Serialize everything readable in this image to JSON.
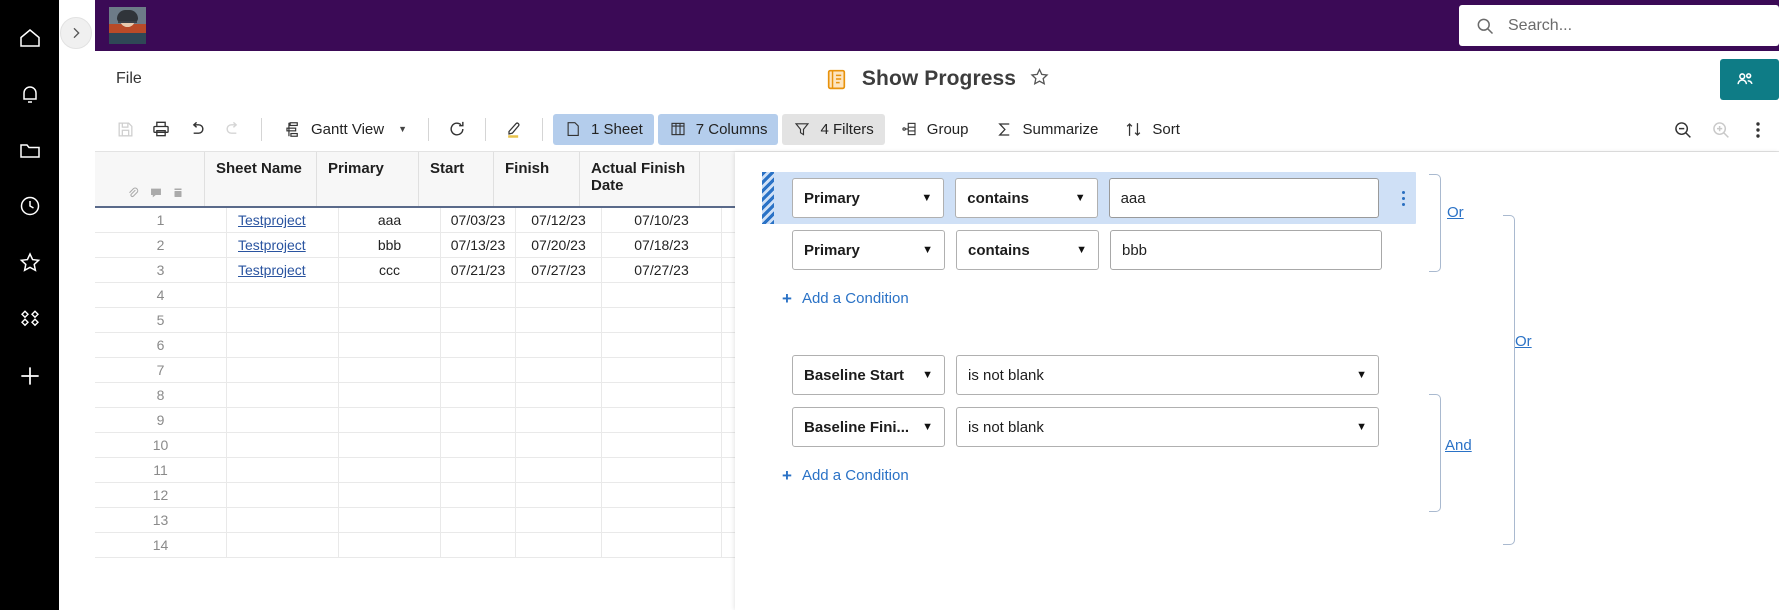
{
  "rail": {
    "items": [
      {
        "name": "home-icon",
        "label": "Home"
      },
      {
        "name": "notifications-icon",
        "label": "Notifications"
      },
      {
        "name": "browse-folder-icon",
        "label": "Browse"
      },
      {
        "name": "recents-clock-icon",
        "label": "Recents"
      },
      {
        "name": "favorites-star-icon",
        "label": "Favorites"
      },
      {
        "name": "workapps-icon",
        "label": "WorkApps"
      },
      {
        "name": "create-plus-icon",
        "label": "Create"
      }
    ],
    "expand_label": "Expand"
  },
  "topbar": {
    "search_placeholder": "Search...",
    "avatar_label": "User avatar",
    "bg_color": "#3b0a56"
  },
  "titlebar": {
    "file_label": "File",
    "doc_title": "Show Progress",
    "doc_icon": "sheet-icon",
    "favorite_icon": "star-outline-icon",
    "share_label": "",
    "share_color": "#0e7c86"
  },
  "toolbar": {
    "save_label": "Save",
    "print_label": "Print",
    "undo_label": "Undo",
    "redo_label": "Redo",
    "view_label": "Gantt View",
    "refresh_label": "Refresh",
    "highlight_label": "Highlight",
    "sheet_label": "1 Sheet",
    "columns_label": "7 Columns",
    "filters_label": "4 Filters",
    "group_label": "Group",
    "summarize_label": "Summarize",
    "sort_label": "Sort",
    "zoom_out_label": "Zoom out",
    "zoom_in_label": "Zoom in",
    "more_label": "More"
  },
  "grid": {
    "columns": [
      {
        "label": "Sheet Name",
        "key": "sheet"
      },
      {
        "label": "Primary",
        "key": "primary"
      },
      {
        "label": "Start",
        "key": "start"
      },
      {
        "label": "Finish",
        "key": "finish"
      },
      {
        "label": "Actual Finish Date",
        "key": "actual"
      }
    ],
    "header_icons": [
      "attachment-icon",
      "comment-icon",
      "proof-icon"
    ],
    "rows": [
      {
        "num": "1",
        "sheet": "Testproject",
        "primary": "aaa",
        "start": "07/03/23",
        "finish": "07/12/23",
        "actual": "07/10/23"
      },
      {
        "num": "2",
        "sheet": "Testproject",
        "primary": "bbb",
        "start": "07/13/23",
        "finish": "07/20/23",
        "actual": "07/18/23"
      },
      {
        "num": "3",
        "sheet": "Testproject",
        "primary": "ccc",
        "start": "07/21/23",
        "finish": "07/27/23",
        "actual": "07/27/23"
      },
      {
        "num": "4",
        "sheet": "",
        "primary": "",
        "start": "",
        "finish": "",
        "actual": ""
      },
      {
        "num": "5",
        "sheet": "",
        "primary": "",
        "start": "",
        "finish": "",
        "actual": ""
      },
      {
        "num": "6",
        "sheet": "",
        "primary": "",
        "start": "",
        "finish": "",
        "actual": ""
      },
      {
        "num": "7",
        "sheet": "",
        "primary": "",
        "start": "",
        "finish": "",
        "actual": ""
      },
      {
        "num": "8",
        "sheet": "",
        "primary": "",
        "start": "",
        "finish": "",
        "actual": ""
      },
      {
        "num": "9",
        "sheet": "",
        "primary": "",
        "start": "",
        "finish": "",
        "actual": ""
      },
      {
        "num": "10",
        "sheet": "",
        "primary": "",
        "start": "",
        "finish": "",
        "actual": ""
      },
      {
        "num": "11",
        "sheet": "",
        "primary": "",
        "start": "",
        "finish": "",
        "actual": ""
      },
      {
        "num": "12",
        "sheet": "",
        "primary": "",
        "start": "",
        "finish": "",
        "actual": ""
      },
      {
        "num": "13",
        "sheet": "",
        "primary": "",
        "start": "",
        "finish": "",
        "actual": ""
      },
      {
        "num": "14",
        "sheet": "",
        "primary": "",
        "start": "",
        "finish": "",
        "actual": ""
      }
    ]
  },
  "filter_panel": {
    "group_one": {
      "conditions": [
        {
          "field": "Primary",
          "operator": "contains",
          "value": "aaa",
          "selected": true,
          "has_value_input": true,
          "kebab": "row-menu-icon"
        },
        {
          "field": "Primary",
          "operator": "contains",
          "value": "bbb",
          "selected": false,
          "has_value_input": true
        }
      ],
      "connector": "Or",
      "add_label": "Add a Condition"
    },
    "group_two": {
      "conditions": [
        {
          "field": "Baseline Start",
          "operator": "is not blank",
          "has_value_input": false
        },
        {
          "field": "Baseline Fini...",
          "operator": "is not blank",
          "has_value_input": false
        }
      ],
      "connector": "And",
      "add_label": "Add a Condition"
    },
    "outer_connector": "Or",
    "link_color": "#2a72c6"
  }
}
